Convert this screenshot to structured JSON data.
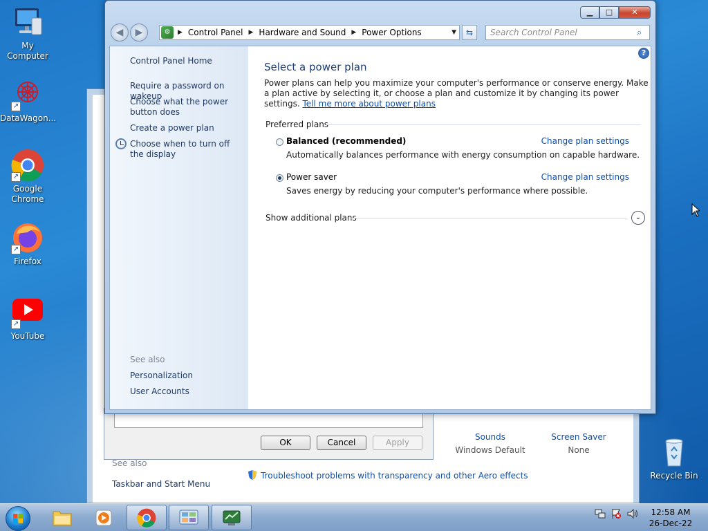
{
  "desktop": {
    "icons": [
      {
        "label": "My Computer"
      },
      {
        "label": "DataWagon..."
      },
      {
        "label": "Google Chrome"
      },
      {
        "label": "Firefox"
      },
      {
        "label": "YouTube"
      },
      {
        "label": "Recycle Bin"
      }
    ]
  },
  "window": {
    "address": {
      "crumbs": [
        "Control Panel",
        "Hardware and Sound",
        "Power Options"
      ]
    },
    "search_placeholder": "Search Control Panel",
    "left_pane": {
      "home": "Control Panel Home",
      "links": [
        "Require a password on wakeup",
        "Choose what the power button does",
        "Create a power plan",
        "Choose when to turn off the display"
      ],
      "see_also": "See also",
      "see_also_links": [
        "Personalization",
        "User Accounts"
      ]
    },
    "main": {
      "title": "Select a power plan",
      "description": "Power plans can help you maximize your computer's performance or conserve energy. Make a plan active by selecting it, or choose a plan and customize it by changing its power settings.",
      "tell_more": "Tell me more about power plans",
      "preferred_plans": "Preferred plans",
      "plans": [
        {
          "name": "Balanced (recommended)",
          "description": "Automatically balances performance with energy consumption on capable hardware.",
          "link": "Change plan settings",
          "selected": false
        },
        {
          "name": "Power saver",
          "description": "Saves energy by reducing your computer's performance where possible.",
          "link": "Change plan settings",
          "selected": true
        }
      ],
      "additional": "Show additional plans"
    }
  },
  "background": {
    "buttons": {
      "ok": "OK",
      "cancel": "Cancel",
      "apply": "Apply"
    },
    "see_also": "See also",
    "taskbar_link": "Taskbar and Start Menu",
    "troubleshoot": "Troubleshoot problems with transparency and other Aero effects",
    "sounds": {
      "label": "Sounds",
      "value": "Windows Default"
    },
    "screensaver": {
      "label": "Screen Saver",
      "value": "None"
    }
  },
  "taskbar": {
    "time": "12:58 AM",
    "date": "26-Dec-22"
  }
}
